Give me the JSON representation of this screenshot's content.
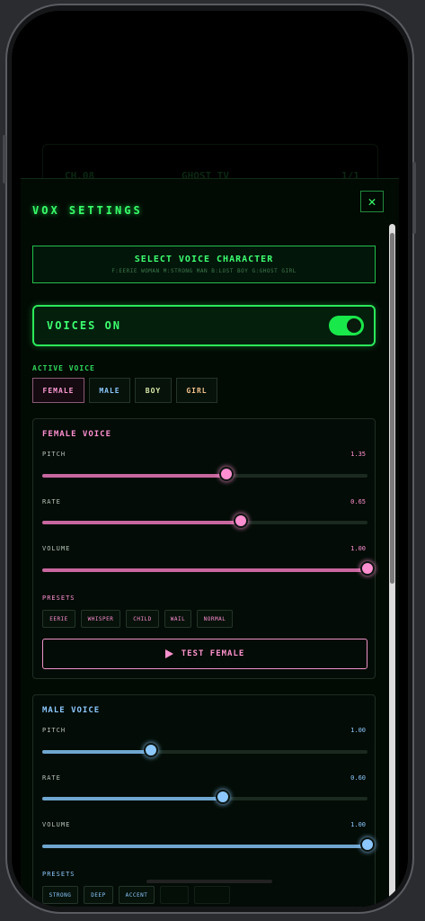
{
  "background": {
    "left_label": "CH.08",
    "center_label": "GHOST TV",
    "right_label": "1/1"
  },
  "vox": {
    "title": "VOX SETTINGS",
    "close_label": "✕",
    "select_voice": {
      "label": "SELECT VOICE CHARACTER",
      "shortcuts": "F:EERIE WOMAN  M:STRONG MAN  B:LOST BOY  G:GHOST GIRL"
    },
    "voices_toggle": {
      "label": "VOICES ON",
      "on": true
    },
    "active_voice": {
      "label": "ACTIVE VOICE",
      "options": [
        "FEMALE",
        "MALE",
        "BOY",
        "GIRL"
      ],
      "selected": "FEMALE"
    },
    "female": {
      "title": "FEMALE VOICE",
      "accent": "#ff8fd1",
      "sliders": [
        {
          "label": "PITCH",
          "value": "1.35",
          "level": 0.565
        },
        {
          "label": "RATE",
          "value": "0.65",
          "level": 0.61
        },
        {
          "label": "VOLUME",
          "value": "1.00",
          "level": 1.0
        }
      ],
      "presets_label": "PRESETS",
      "presets": [
        "EERIE",
        "WHISPER",
        "CHILD",
        "WAIL",
        "NORMAL"
      ],
      "test_label": "TEST FEMALE"
    },
    "male": {
      "title": "MALE VOICE",
      "accent": "#8cc8ff",
      "sliders": [
        {
          "label": "PITCH",
          "value": "1.00",
          "level": 0.333
        },
        {
          "label": "RATE",
          "value": "0.60",
          "level": 0.555
        },
        {
          "label": "VOLUME",
          "value": "1.00",
          "level": 1.0
        }
      ],
      "presets_label": "PRESETS",
      "presets": [
        "STRONG",
        "DEEP",
        "ACCENT",
        "",
        ""
      ]
    }
  }
}
